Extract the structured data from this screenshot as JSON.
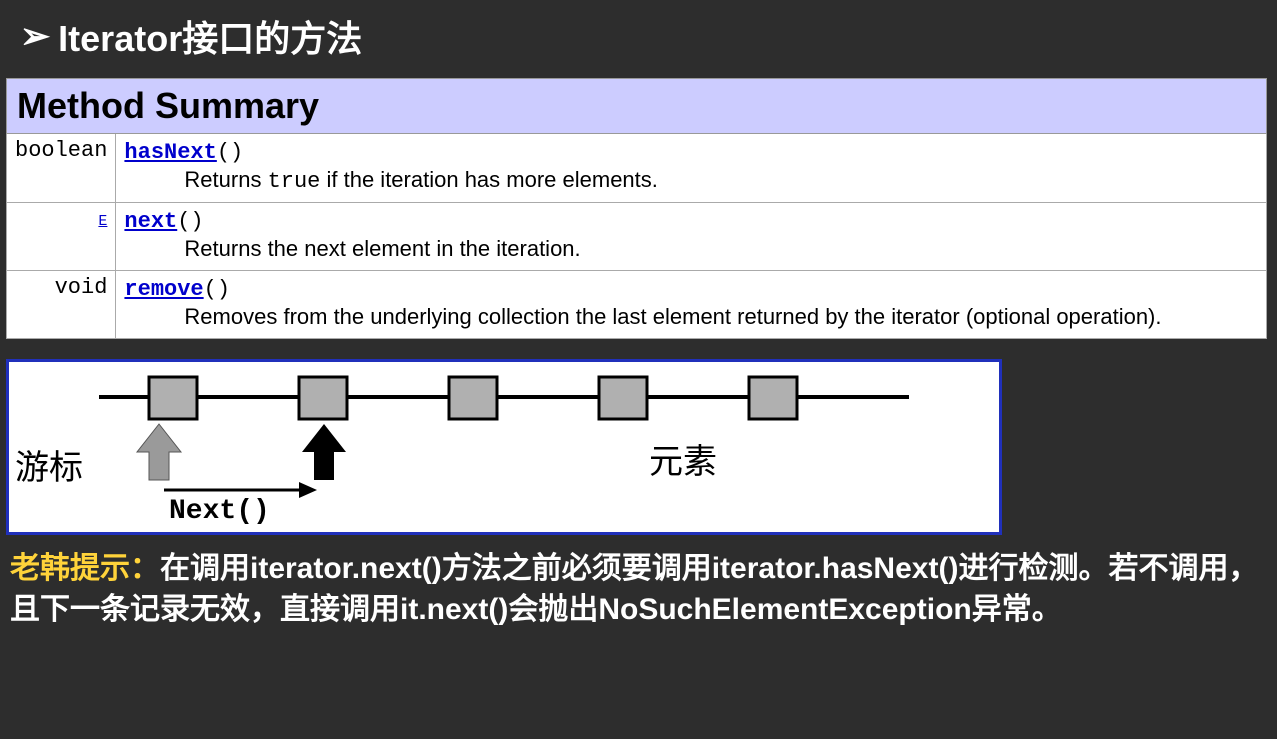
{
  "title": "Iterator接口的方法",
  "table": {
    "heading": "Method Summary",
    "rows": [
      {
        "returnType": "boolean",
        "method": "hasNext",
        "descPrefix": "Returns ",
        "descCode": "true",
        "descSuffix": " if the iteration has more elements."
      },
      {
        "returnType": "E",
        "method": "next",
        "descPrefix": "Returns the next element in the iteration.",
        "descCode": "",
        "descSuffix": ""
      },
      {
        "returnType": "void",
        "method": "remove",
        "descPrefix": "Removes from the underlying collection the last element returned by the iterator (optional operation).",
        "descCode": "",
        "descSuffix": ""
      }
    ]
  },
  "diagram": {
    "cursorLabel": "游标",
    "elementLabel": "元素",
    "nextLabel": "Next()"
  },
  "tip": {
    "prefix": "老韩提示：",
    "body": "在调用iterator.next()方法之前必须要调用iterator.hasNext()进行检测。若不调用，且下一条记录无效，直接调用it.next()会抛出NoSuchElementException异常。"
  }
}
